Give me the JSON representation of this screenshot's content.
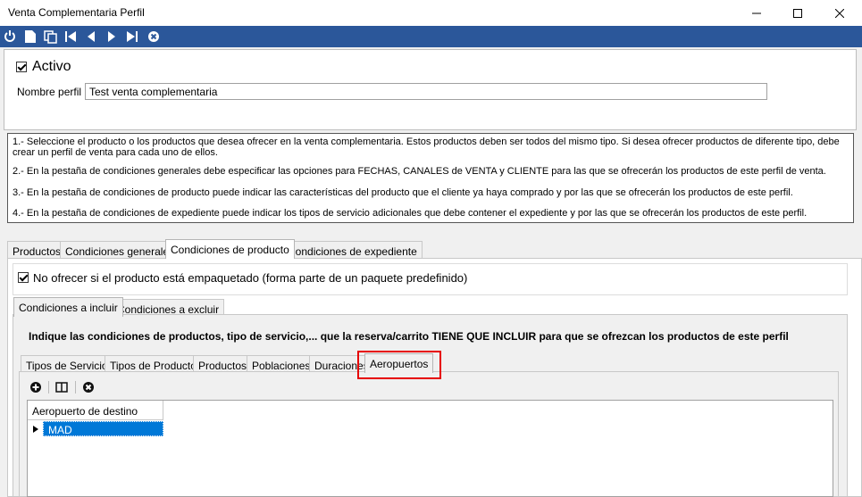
{
  "window": {
    "title": "Venta Complementaria Perfil"
  },
  "toolbar": {
    "icons": [
      "power-icon",
      "new-document-icon",
      "copy-icon",
      "first-record-icon",
      "previous-record-icon",
      "next-record-icon",
      "last-record-icon",
      "cancel-icon"
    ],
    "color": "#2b579a"
  },
  "profile": {
    "activo_label": "Activo",
    "activo_checked": true,
    "nombre_label": "Nombre perfil",
    "nombre_value": "Test venta complementaria"
  },
  "instructions": [
    "1.-  Seleccione el producto o los productos que desea ofrecer en la venta complementaria. Estos productos deben ser todos del mismo tipo. Si desea ofrecer productos de diferente tipo, debe crear un perfil de venta para cada uno de ellos.",
    "2.- En la pestaña de condiciones generales debe especificar las opciones para FECHAS, CANALES de VENTA y CLIENTE para las que se ofrecerán los productos de este perfil de venta.",
    "3.- En la pestaña de condiciones de producto puede indicar las características del producto que el cliente ya haya comprado y por las que se ofrecerán los productos de este perfil.",
    "4.- En la pestaña de condiciones de expediente puede indicar los tipos de servicio adicionales que debe contener el expediente y por las que se ofrecerán los productos de este perfil."
  ],
  "main_tabs": [
    "Productos",
    "Condiciones generales",
    "Condiciones de producto",
    "Condiciones de expediente"
  ],
  "main_tab_active": "Condiciones de producto",
  "no_ofrecer": {
    "label": "No ofrecer si el producto está empaquetado (forma parte de un paquete predefinido)",
    "checked": true
  },
  "sub_tabs": [
    "Condiciones a incluir",
    "Condiciones a excluir"
  ],
  "sub_tab_active": "Condiciones a incluir",
  "include_header": "Indique las condiciones de productos, tipo de servicio,... que la reserva/carrito TIENE QUE INCLUIR para que se ofrezcan los productos de este perfil",
  "cond_tabs": [
    "Tipos de Servicio",
    "Tipos de Producto",
    "Productos",
    "Poblaciones",
    "Duraciones",
    "Aeropuertos"
  ],
  "cond_tab_active": "Aeropuertos",
  "grid_toolbar": [
    "add-icon",
    "columns-icon",
    "delete-icon"
  ],
  "grid": {
    "column": "Aeropuerto de destino",
    "rows": [
      "MAD"
    ],
    "selected_color": "#0078d7"
  },
  "highlight_color": "#e60000"
}
